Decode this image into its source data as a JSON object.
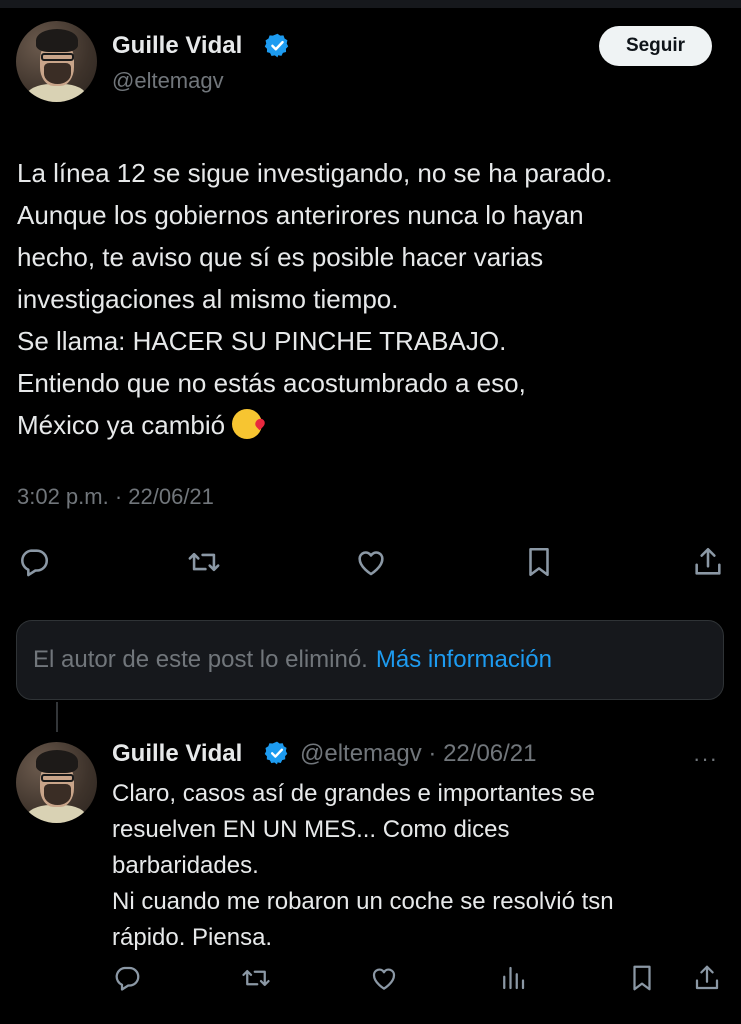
{
  "main_post": {
    "author_name": "Guille Vidal",
    "handle": "@eltemagv",
    "follow_label": "Seguir",
    "text_lines": [
      "La línea 12 se sigue investigando, no se ha parado.",
      "Aunque los gobiernos anterirores nunca lo hayan",
      "hecho, te aviso que sí es posible hacer varias",
      "investigaciones al mismo tiempo.",
      "Se llama: HACER SU PINCHE TRABAJO.",
      "Entiendo que no estás acostumbrado a eso,",
      "México ya cambió"
    ],
    "emoji": "face-blowing-kiss",
    "timestamp": "3:02 p.m. · 22/06/21",
    "actions": [
      "reply-icon",
      "repost-icon",
      "like-icon",
      "bookmark-icon",
      "share-icon"
    ]
  },
  "deleted_notice": {
    "text": "El autor de este post lo eliminó.",
    "link": "Más información"
  },
  "reply_post": {
    "author_name": "Guille Vidal",
    "handle_date": "@eltemagv · 22/06/21",
    "more": "···",
    "text_lines": [
      "Claro, casos así de grandes e importantes se",
      "resuelven EN UN MES... Como dices",
      "barbaridades.",
      "Ni cuando me robaron un coche se resolvió tsn",
      "rápido. Piensa."
    ],
    "actions": [
      "reply-icon",
      "repost-icon",
      "like-icon",
      "views-icon",
      "bookmark-icon",
      "share-icon"
    ]
  },
  "colors": {
    "background": "#000000",
    "text": "#e7e9ea",
    "secondary": "#71767b",
    "link": "#1d9bf0",
    "verified": "#1d9bf0"
  }
}
